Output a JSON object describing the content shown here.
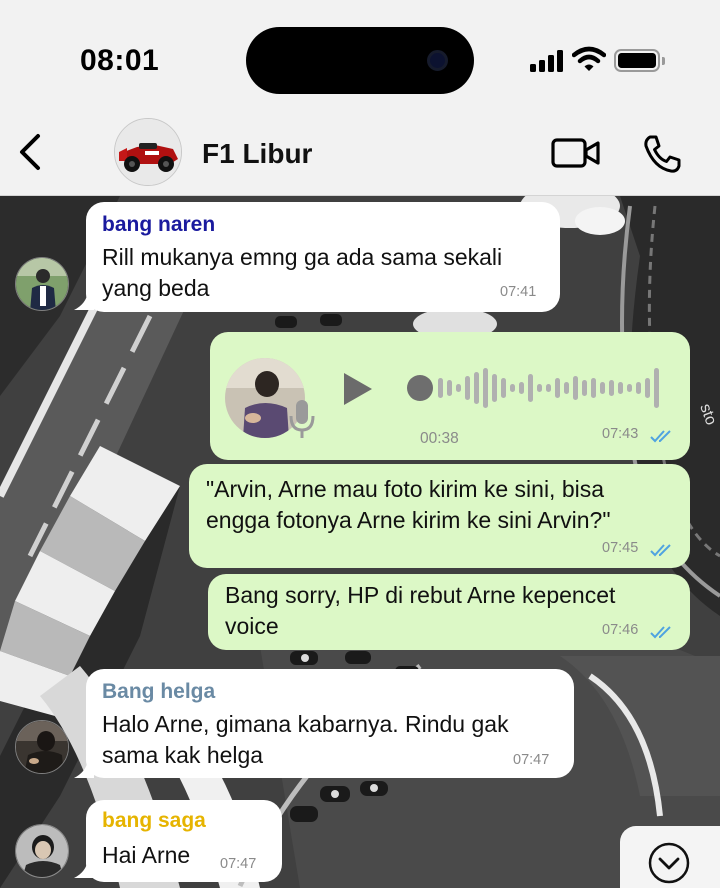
{
  "status_bar": {
    "time": "08:01"
  },
  "header": {
    "title": "F1 Libur"
  },
  "messages": [
    {
      "sender": "bang naren",
      "sender_color": "#1a1a9e",
      "text_line1": "Rill mukanya emng ga ada sama sekali",
      "text_line2": "yang beda",
      "time": "07:41"
    },
    {
      "type": "voice",
      "duration": "00:38",
      "time": "07:43"
    },
    {
      "text_line1": "\"Arvin, Arne mau foto kirim ke sini, bisa",
      "text_line2": "engga fotonya Arne kirim ke sini Arvin?\"",
      "time": "07:45"
    },
    {
      "text_line1": "Bang sorry, HP di rebut Arne kepencet",
      "text_line2": "voice",
      "time": "07:46"
    },
    {
      "sender": "Bang helga",
      "sender_color": "#6a8aa4",
      "text_line1": "Halo Arne, gimana kabarnya. Rindu gak",
      "text_line2": "sama kak helga",
      "time": "07:47"
    },
    {
      "sender": "bang saga",
      "sender_color": "#e6b400",
      "text_line1": "Hai Arne",
      "time": "07:47"
    }
  ],
  "colors": {
    "outgoing_bubble": "#dcf8c6",
    "incoming_bubble": "#ffffff",
    "read_ticks": "#4fa3e0"
  },
  "icons": [
    "back-chevron-icon",
    "video-call-icon",
    "phone-call-icon",
    "play-icon",
    "microphone-icon",
    "double-check-icon",
    "chevron-down-icon"
  ]
}
